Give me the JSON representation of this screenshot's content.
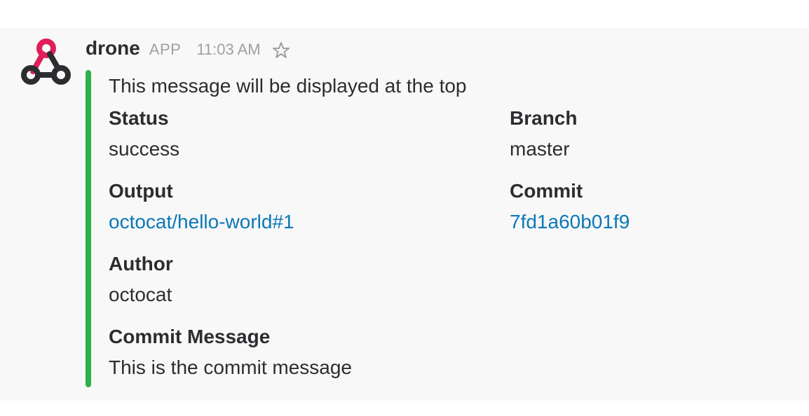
{
  "message": {
    "username": "drone",
    "app_badge": "APP",
    "timestamp": "11:03 AM",
    "avatar_icon": "webhook-icon",
    "star_icon": "star-outline-icon",
    "colors": {
      "attachment_bar": "#2eb04a",
      "link": "#0b78b8",
      "avatar_red": "#e01e5a",
      "avatar_dark": "#2c2d30"
    },
    "attachment": {
      "pretext": "This message will be displayed at the top",
      "fields": {
        "status": {
          "title": "Status",
          "value": "success"
        },
        "branch": {
          "title": "Branch",
          "value": "master"
        },
        "output": {
          "title": "Output",
          "value": "octocat/hello-world#1"
        },
        "commit": {
          "title": "Commit",
          "value": "7fd1a60b01f9"
        },
        "author": {
          "title": "Author",
          "value": "octocat"
        },
        "commit_message": {
          "title": "Commit Message",
          "value": "This is the commit message"
        }
      }
    }
  }
}
